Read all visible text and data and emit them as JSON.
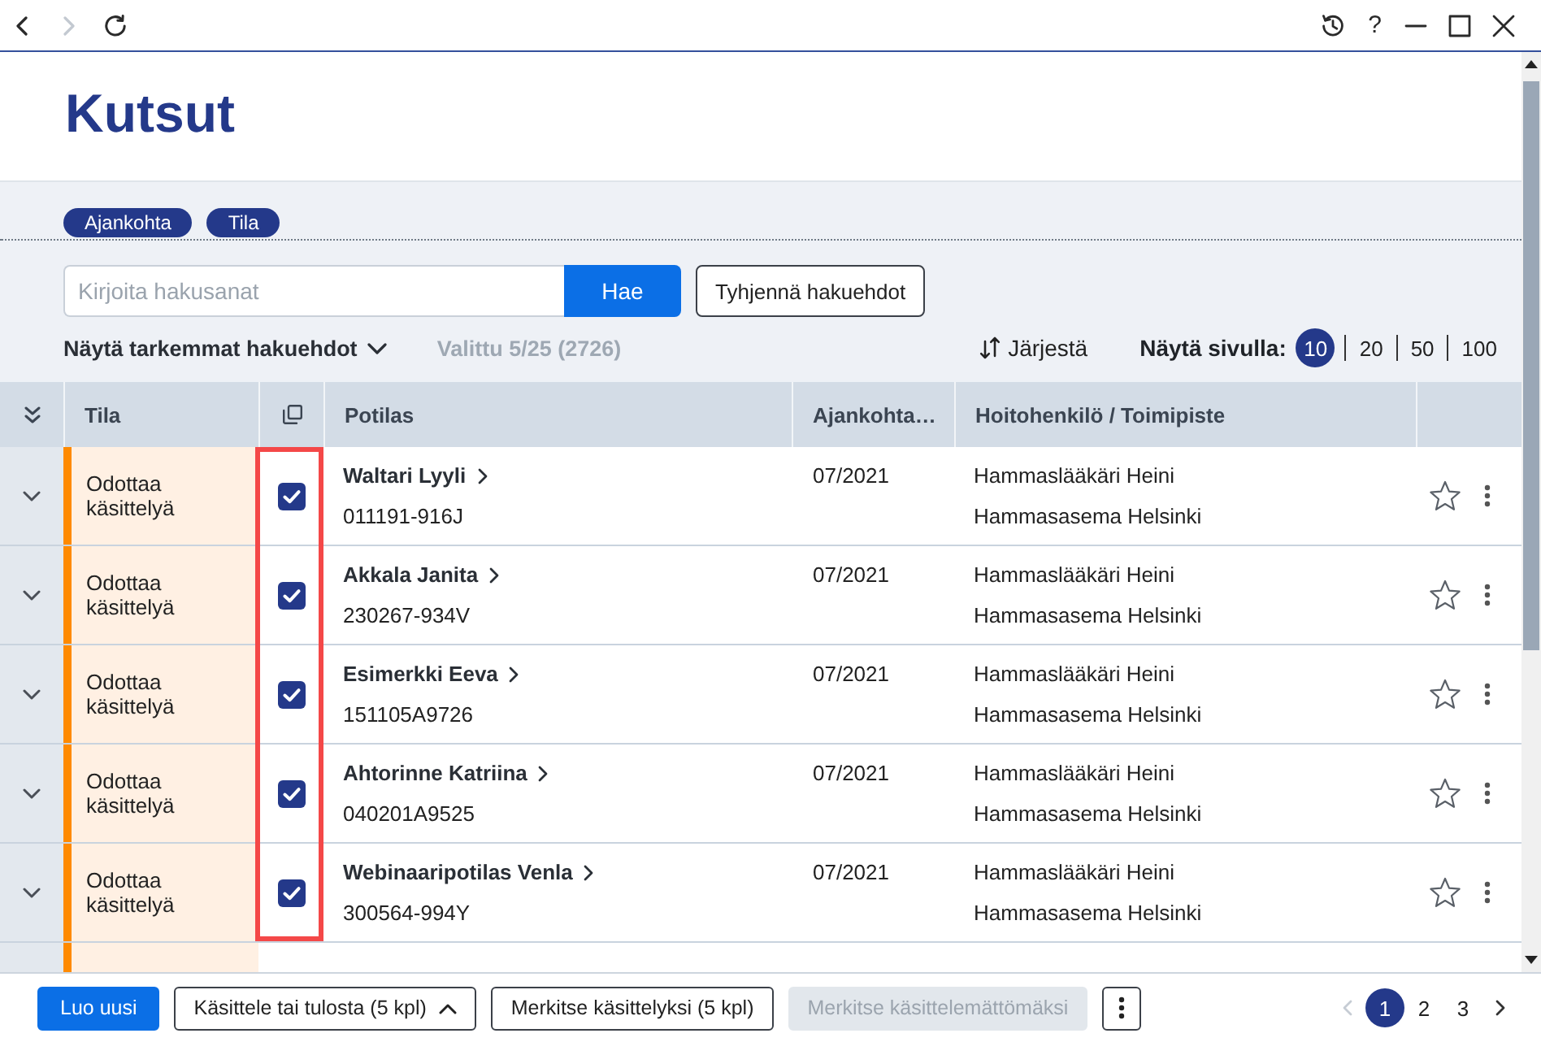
{
  "window": {
    "nav_buttons": [
      {
        "kind": "back",
        "disabled": false
      },
      {
        "kind": "forward",
        "disabled": true
      },
      {
        "kind": "reload",
        "disabled": false
      }
    ],
    "tools": [
      {
        "kind": "history"
      },
      {
        "kind": "help",
        "label": "?"
      },
      {
        "kind": "minimize"
      },
      {
        "kind": "maximize"
      },
      {
        "kind": "close"
      }
    ]
  },
  "page": {
    "title": "Kutsut"
  },
  "filter_chips": [
    "Ajankohta",
    "Tila"
  ],
  "search": {
    "placeholder": "Kirjoita hakusanat",
    "submit": "Hae",
    "clear": "Tyhjennä hakuehdot"
  },
  "list_toolbar": {
    "advanced_search": "Näytä tarkemmat hakuehdot",
    "selection": "Valittu 5/25 (2726)",
    "sort": "Järjestä",
    "page_size_label": "Näytä sivulla:",
    "page_sizes": [
      {
        "label": "10",
        "selected": true
      },
      {
        "label": "20",
        "selected": false
      },
      {
        "label": "50",
        "selected": false
      },
      {
        "label": "100",
        "selected": false
      }
    ]
  },
  "table": {
    "columns": [
      {
        "kind": "expand"
      },
      {
        "kind": "status",
        "label": "Tila"
      },
      {
        "kind": "select",
        "highlighted": true
      },
      {
        "kind": "patient",
        "label": "Potilas"
      },
      {
        "kind": "date",
        "label": "Ajankohta…"
      },
      {
        "kind": "staff",
        "label": "Hoitohenkilö / Toimipiste"
      },
      {
        "kind": "actions"
      }
    ],
    "rows": [
      {
        "expanded": false,
        "status": "Odottaa käsittelyä",
        "checked": true,
        "patient": "Waltari Lyyli",
        "patient_id": "011191-916J",
        "date": "07/2021",
        "staff": "Hammaslääkäri Heini",
        "location": "Hammasasema Helsinki",
        "starred": false
      },
      {
        "expanded": false,
        "status": "Odottaa käsittelyä",
        "checked": true,
        "patient": "Akkala Janita",
        "patient_id": "230267-934V",
        "date": "07/2021",
        "staff": "Hammaslääkäri Heini",
        "location": "Hammasasema Helsinki",
        "starred": false
      },
      {
        "expanded": false,
        "status": "Odottaa käsittelyä",
        "checked": true,
        "patient": "Esimerkki Eeva",
        "patient_id": "151105A9726",
        "date": "07/2021",
        "staff": "Hammaslääkäri Heini",
        "location": "Hammasasema Helsinki",
        "starred": false
      },
      {
        "expanded": false,
        "status": "Odottaa käsittelyä",
        "checked": true,
        "patient": "Ahtorinne Katriina",
        "patient_id": "040201A9525",
        "date": "07/2021",
        "staff": "Hammaslääkäri Heini",
        "location": "Hammasasema Helsinki",
        "starred": false
      },
      {
        "expanded": false,
        "status": "Odottaa käsittelyä",
        "checked": true,
        "patient": "Webinaaripotilas Venla",
        "patient_id": "300564-994Y",
        "date": "07/2021",
        "staff": "Hammaslääkäri Heini",
        "location": "Hammasasema Helsinki",
        "starred": false
      }
    ]
  },
  "footer": {
    "buttons": [
      {
        "kind": "primary",
        "label": "Luo uusi",
        "disabled": false
      },
      {
        "kind": "menu",
        "label": "Käsittele tai tulosta (5 kpl)",
        "disabled": false
      },
      {
        "kind": "secondary",
        "label": "Merkitse käsittelyksi (5 kpl)",
        "disabled": false
      },
      {
        "kind": "secondary",
        "label": "Merkitse käsittelemättömäksi",
        "disabled": true
      },
      {
        "kind": "more",
        "disabled": false
      }
    ],
    "pagination": {
      "previous_disabled": true,
      "pages": [
        {
          "label": "1",
          "selected": true
        },
        {
          "label": "2",
          "selected": false
        },
        {
          "label": "3",
          "selected": false
        }
      ],
      "next_disabled": false
    }
  }
}
